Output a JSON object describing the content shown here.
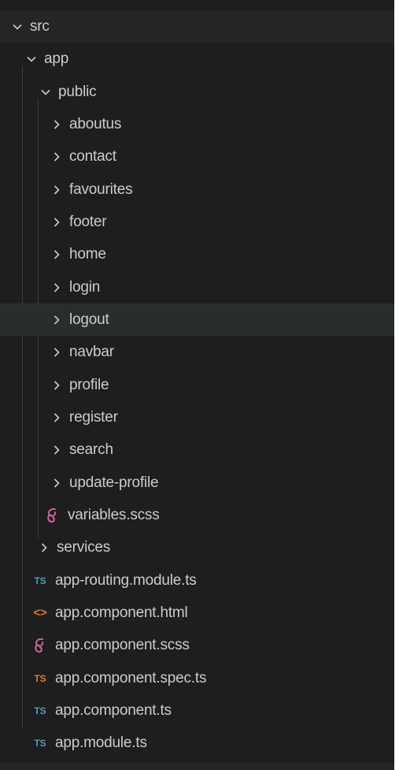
{
  "tree": {
    "src": {
      "label": "src"
    },
    "app": {
      "label": "app"
    },
    "public": {
      "label": "public"
    },
    "public_folders": [
      {
        "label": "aboutus"
      },
      {
        "label": "contact"
      },
      {
        "label": "favourites"
      },
      {
        "label": "footer"
      },
      {
        "label": "home"
      },
      {
        "label": "login"
      },
      {
        "label": "logout"
      },
      {
        "label": "navbar"
      },
      {
        "label": "profile"
      },
      {
        "label": "register"
      },
      {
        "label": "search"
      },
      {
        "label": "update-profile"
      }
    ],
    "variables_file": {
      "label": "variables.scss",
      "icon": "sass-icon"
    },
    "services": {
      "label": "services"
    },
    "app_files": [
      {
        "label": "app-routing.module.ts",
        "icon": "typescript-icon",
        "badge": "TS"
      },
      {
        "label": "app.component.html",
        "icon": "html-icon",
        "badge": "<>"
      },
      {
        "label": "app.component.scss",
        "icon": "sass-icon"
      },
      {
        "label": "app.component.spec.ts",
        "icon": "typescript-test-icon",
        "badge": "TS"
      },
      {
        "label": "app.component.ts",
        "icon": "typescript-icon",
        "badge": "TS"
      },
      {
        "label": "app.module.ts",
        "icon": "typescript-icon",
        "badge": "TS"
      }
    ]
  },
  "colors": {
    "background": "#1e1e1e",
    "text": "#cccccc",
    "hover_row": "#2a2d2e",
    "ts_blue": "#519aba",
    "ts_orange": "#e37933",
    "sass_pink": "#cd6799"
  },
  "state": {
    "hovered_item": "logout"
  }
}
